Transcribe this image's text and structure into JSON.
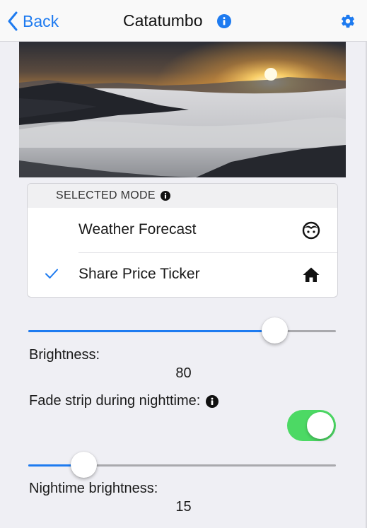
{
  "nav": {
    "back_label": "Back",
    "title": "Catatumbo",
    "info_icon": "info-icon",
    "settings_icon": "gear-icon"
  },
  "colors": {
    "accent": "#1e7bf0",
    "toggle_on": "#4cd964",
    "background": "#efeff4"
  },
  "mode": {
    "header": "SELECTED MODE",
    "options": [
      {
        "label": "Weather Forecast",
        "icon": "face-icon",
        "selected": false
      },
      {
        "label": "Share Price Ticker",
        "icon": "home-icon",
        "selected": true
      }
    ]
  },
  "brightness": {
    "label": "Brightness:",
    "value": "80",
    "slider_fraction": 0.8
  },
  "fade": {
    "label": "Fade strip during nighttime:",
    "enabled": true
  },
  "night_brightness": {
    "label": "Nightime brightness:",
    "value": "15",
    "slider_fraction": 0.18
  }
}
